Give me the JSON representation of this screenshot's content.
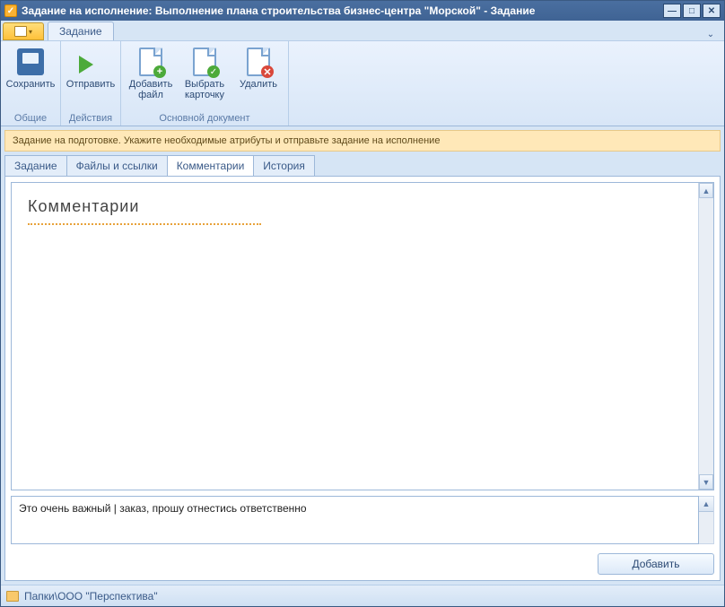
{
  "window": {
    "title": "Задание на исполнение: Выполнение плана строительства бизнес-центра \"Морской\" - Задание"
  },
  "ribbon": {
    "active_tab": "Задание",
    "groups": [
      {
        "label": "Общие",
        "buttons": [
          {
            "label": "Сохранить",
            "icon": "save-icon"
          }
        ]
      },
      {
        "label": "Действия",
        "buttons": [
          {
            "label": "Отправить",
            "icon": "send-icon"
          }
        ]
      },
      {
        "label": "Основной документ",
        "buttons": [
          {
            "label": "Добавить\nфайл",
            "icon": "add-file-icon"
          },
          {
            "label": "Выбрать\nкарточку",
            "icon": "select-card-icon"
          },
          {
            "label": "Удалить",
            "icon": "delete-icon"
          }
        ]
      }
    ]
  },
  "info_bar": "Задание на подготовке. Укажите необходимые атрибуты и отправьте задание на исполнение",
  "tabs": {
    "items": [
      "Задание",
      "Файлы и ссылки",
      "Комментарии",
      "История"
    ],
    "active_index": 2
  },
  "comments": {
    "heading": "Комментарии",
    "input_value": "Это очень важный | заказ, прошу отнестись ответственно",
    "add_button": "Добавить"
  },
  "statusbar": {
    "path": "Папки\\ООО \"Перспектива\""
  }
}
